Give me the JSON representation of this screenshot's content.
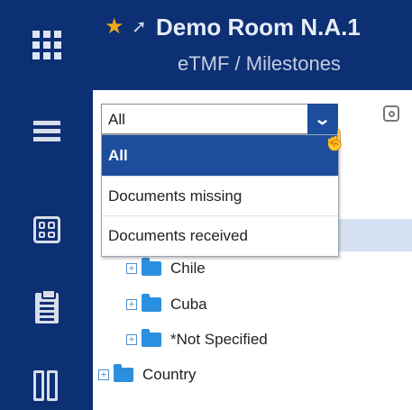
{
  "header": {
    "room_title": "Demo Room N.A.1",
    "breadcrumb": "eTMF / Milestones",
    "star_glyph": "★",
    "pin_glyph": "➚",
    "background": "#0d2f73",
    "star_color": "#f2a61c"
  },
  "nav": {
    "items": [
      {
        "icon": "hamburger-menu-icon"
      },
      {
        "icon": "dashboard-grid-icon"
      },
      {
        "icon": "clipboard-icon"
      },
      {
        "icon": "lab-samples-icon"
      }
    ]
  },
  "filter": {
    "selected": "All",
    "arrow_glyph": "⌄",
    "options": [
      {
        "label": "All",
        "selected": true
      },
      {
        "label": "Documents missing",
        "selected": false
      },
      {
        "label": "Documents received",
        "selected": false
      }
    ],
    "accent": "#1d4e9e"
  },
  "tree": {
    "expander_glyph": "+",
    "children": [
      {
        "label": "Chile"
      },
      {
        "label": "Cuba"
      },
      {
        "label": "*Not Specified"
      }
    ],
    "root": {
      "label": "Country"
    },
    "folder_color": "#2b8fe0"
  }
}
